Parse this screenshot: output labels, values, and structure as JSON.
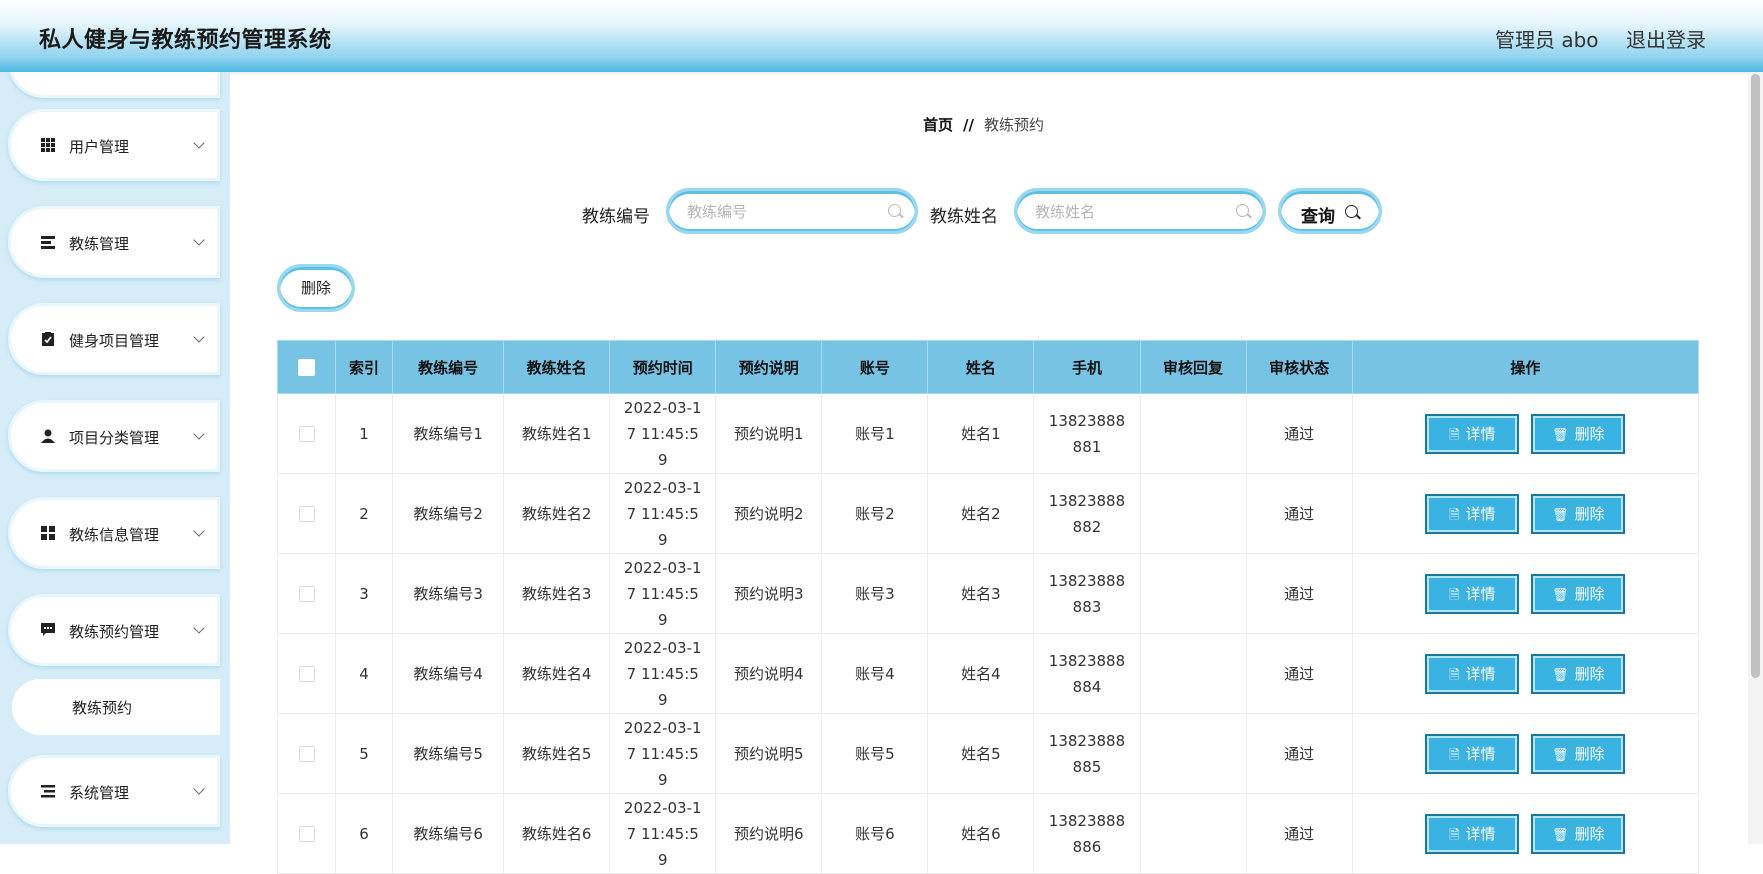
{
  "header": {
    "title": "私人健身与教练预约管理系统",
    "user": "管理员 abo",
    "logout": "退出登录"
  },
  "sidebar": {
    "items": [
      {
        "label": "用户管理",
        "icon": "grid-icon"
      },
      {
        "label": "教练管理",
        "icon": "list-icon"
      },
      {
        "label": "健身项目管理",
        "icon": "clipboard-icon"
      },
      {
        "label": "项目分类管理",
        "icon": "user-icon"
      },
      {
        "label": "教练信息管理",
        "icon": "tiles-icon"
      },
      {
        "label": "教练预约管理",
        "icon": "message-icon"
      },
      {
        "label": "系统管理",
        "icon": "menu-icon"
      }
    ],
    "subitem": "教练预约"
  },
  "breadcrumb": {
    "home": "首页",
    "sep": "//",
    "current": "教练预约"
  },
  "search": {
    "field1_label": "教练编号",
    "field1_placeholder": "教练编号",
    "field2_label": "教练姓名",
    "field2_placeholder": "教练姓名",
    "query_label": "查询"
  },
  "toolbar": {
    "delete_label": "删除"
  },
  "table": {
    "headers": [
      "索引",
      "教练编号",
      "教练姓名",
      "预约时间",
      "预约说明",
      "账号",
      "姓名",
      "手机",
      "审核回复",
      "审核状态",
      "操作"
    ],
    "detail_label": "详情",
    "delete_label": "删除",
    "rows": [
      {
        "index": "1",
        "coach_no": "教练编号1",
        "coach_name": "教练姓名1",
        "time": "2022-03-17 11:45:59",
        "note": "预约说明1",
        "account": "账号1",
        "name": "姓名1",
        "phone": "13823888881",
        "reply": "",
        "status": "通过"
      },
      {
        "index": "2",
        "coach_no": "教练编号2",
        "coach_name": "教练姓名2",
        "time": "2022-03-17 11:45:59",
        "note": "预约说明2",
        "account": "账号2",
        "name": "姓名2",
        "phone": "13823888882",
        "reply": "",
        "status": "通过"
      },
      {
        "index": "3",
        "coach_no": "教练编号3",
        "coach_name": "教练姓名3",
        "time": "2022-03-17 11:45:59",
        "note": "预约说明3",
        "account": "账号3",
        "name": "姓名3",
        "phone": "13823888883",
        "reply": "",
        "status": "通过"
      },
      {
        "index": "4",
        "coach_no": "教练编号4",
        "coach_name": "教练姓名4",
        "time": "2022-03-17 11:45:59",
        "note": "预约说明4",
        "account": "账号4",
        "name": "姓名4",
        "phone": "13823888884",
        "reply": "",
        "status": "通过"
      },
      {
        "index": "5",
        "coach_no": "教练编号5",
        "coach_name": "教练姓名5",
        "time": "2022-03-17 11:45:59",
        "note": "预约说明5",
        "account": "账号5",
        "name": "姓名5",
        "phone": "13823888885",
        "reply": "",
        "status": "通过"
      },
      {
        "index": "6",
        "coach_no": "教练编号6",
        "coach_name": "教练姓名6",
        "time": "2022-03-17 11:45:59",
        "note": "预约说明6",
        "account": "账号6",
        "name": "姓名6",
        "phone": "13823888886",
        "reply": "",
        "status": "通过"
      }
    ]
  }
}
